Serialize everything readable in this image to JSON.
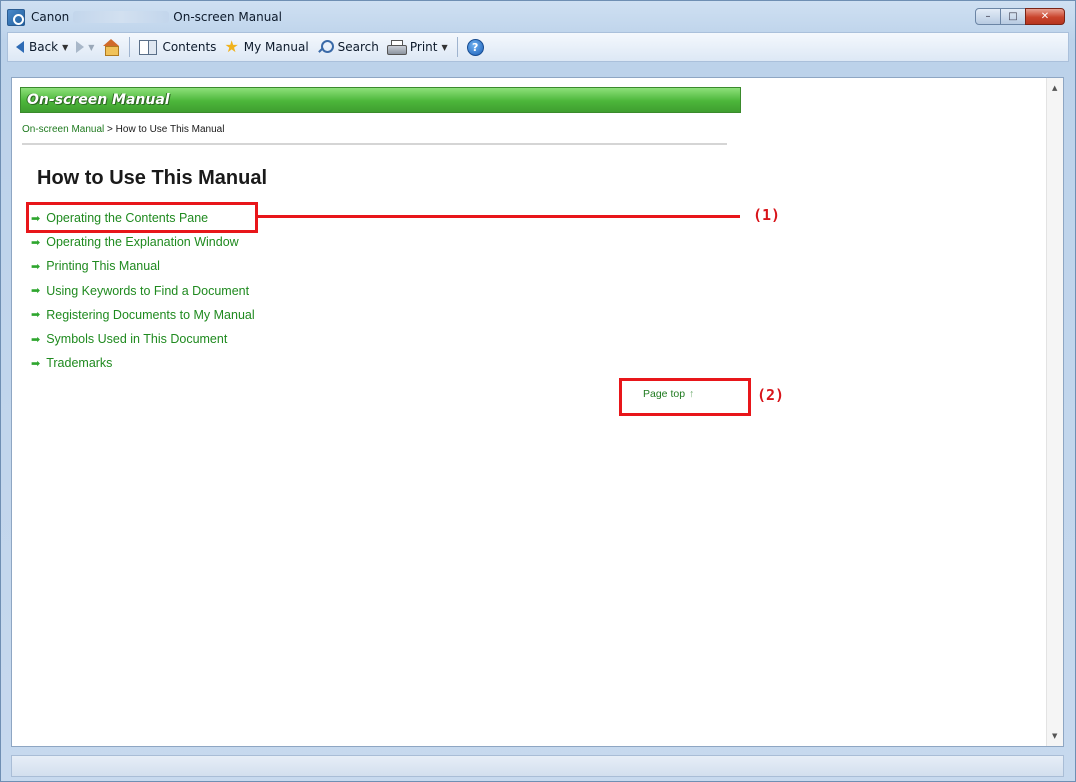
{
  "window": {
    "brand": "Canon",
    "title": "On-screen Manual",
    "minimize": "–",
    "maximize": "□",
    "close": "✕"
  },
  "toolbar": {
    "back": "Back",
    "contents": "Contents",
    "my_manual": "My Manual",
    "search": "Search",
    "print": "Print",
    "help": "?"
  },
  "page": {
    "header": "On-screen Manual",
    "breadcrumb_root": "On-screen Manual",
    "breadcrumb_sep": " > ",
    "breadcrumb_current": "How to Use This Manual",
    "title": "How to Use This Manual",
    "links": [
      "Operating the Contents Pane",
      "Operating the Explanation Window",
      "Printing This Manual",
      "Using Keywords to Find a Document",
      "Registering Documents to My Manual",
      "Symbols Used in This Document",
      "Trademarks"
    ],
    "page_top": "Page top",
    "page_top_arrow": "↑"
  },
  "callouts": {
    "label_1": "(1)",
    "label_2": "(2)",
    "color": "#e8161a"
  },
  "icons": {
    "link_arrow": "➡"
  }
}
